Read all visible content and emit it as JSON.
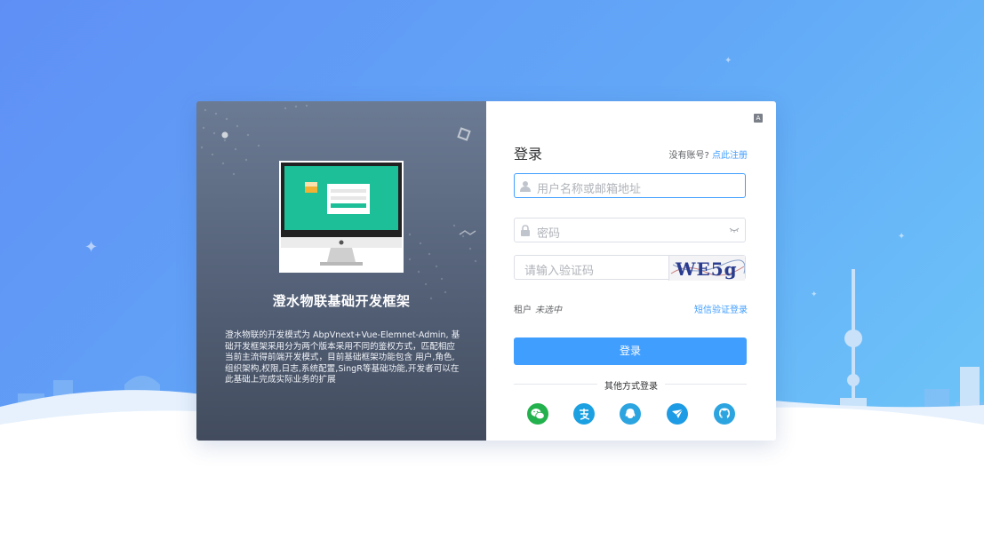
{
  "left_panel": {
    "title": "澄水物联基础开发框架",
    "description": "澄水物联的开发模式为 AbpVnext+Vue-Elemnet-Admin, 基础开发框架采用分为两个版本采用不同的鉴权方式，匹配相应当前主流得前端开发模式，目前基础框架功能包含 用户,角色,组织架构,权限,日志,系统配置,SingR等基础功能,开发者可以在此基础上完成实际业务的扩展"
  },
  "login": {
    "title": "登录",
    "no_account": "没有账号?",
    "register_link": "点此注册",
    "username_placeholder": "用户名称或邮箱地址",
    "password_placeholder": "密码",
    "captcha_placeholder": "请输入验证码",
    "captcha_text": "WE5g",
    "tenant_label": "租户",
    "tenant_value": "未选中",
    "sms_login": "短信验证登录",
    "login_button": "登录",
    "other_methods": "其他方式登录",
    "lang_icon": "translate-icon"
  },
  "social_logins": [
    {
      "name": "wechat-icon",
      "color": "#22b14c"
    },
    {
      "name": "alipay-icon",
      "color": "#1ba0e1"
    },
    {
      "name": "qq-icon",
      "color": "#2ba4e0"
    },
    {
      "name": "feishu-icon",
      "color": "#1d9be4"
    },
    {
      "name": "github-icon",
      "color": "#2ba4e0"
    }
  ],
  "colors": {
    "primary": "#409eff",
    "bg_start": "#5f8ff5",
    "bg_end": "#6fcaf8",
    "left_panel": "#56637a"
  }
}
